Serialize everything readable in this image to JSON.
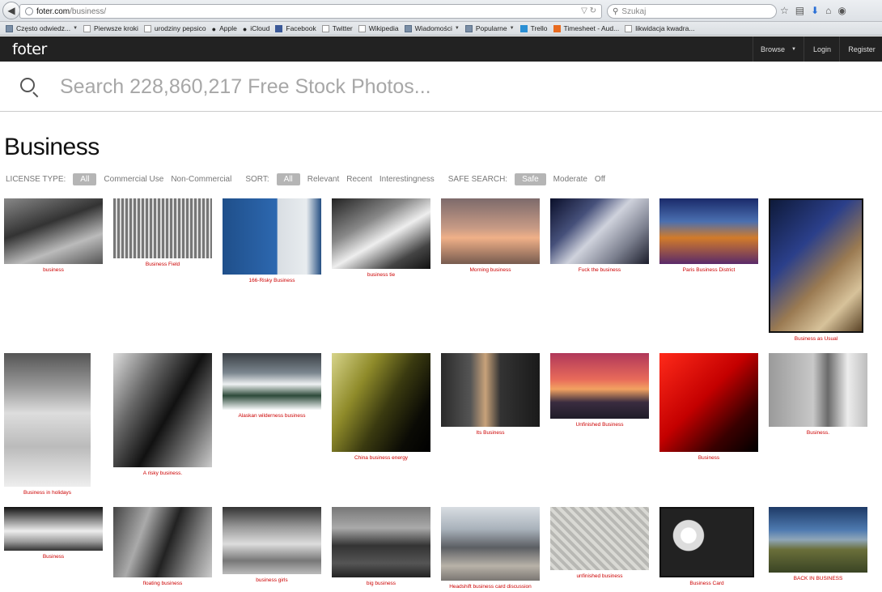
{
  "browser": {
    "url_host": "foter.com",
    "url_path": "/business/",
    "search_placeholder": "Szukaj",
    "bookmarks": [
      {
        "label": "Często odwiedz...",
        "icon": "folder-icon",
        "caret": true
      },
      {
        "label": "Pierwsze kroki",
        "icon": "page-icon"
      },
      {
        "label": "urodziny pepsico",
        "icon": "page-icon"
      },
      {
        "label": "Apple",
        "icon": "apple-icon"
      },
      {
        "label": "iCloud",
        "icon": "apple-icon"
      },
      {
        "label": "Facebook",
        "icon": "facebook-icon"
      },
      {
        "label": "Twitter",
        "icon": "page-icon"
      },
      {
        "label": "Wikipedia",
        "icon": "page-icon"
      },
      {
        "label": "Wiadomości",
        "icon": "folder-icon",
        "caret": true
      },
      {
        "label": "Popularne",
        "icon": "folder-icon",
        "caret": true
      },
      {
        "label": "Trello",
        "icon": "trello-icon"
      },
      {
        "label": "Timesheet - Aud...",
        "icon": "timesheet-icon"
      },
      {
        "label": "likwidacja kwadra...",
        "icon": "page-icon"
      }
    ]
  },
  "header": {
    "logo": "foter",
    "nav": {
      "browse": "Browse",
      "login": "Login",
      "register": "Register"
    }
  },
  "search": {
    "placeholder": "Search 228,860,217 Free Stock Photos..."
  },
  "page": {
    "title": "Business"
  },
  "filters": {
    "license_label": "LICENSE TYPE:",
    "license_options": [
      "All",
      "Commercial Use",
      "Non-Commercial"
    ],
    "sort_label": "SORT:",
    "sort_options": [
      "All",
      "Relevant",
      "Recent",
      "Interestingness"
    ],
    "safe_label": "SAFE SEARCH:",
    "safe_options": [
      "Safe",
      "Moderate",
      "Off"
    ]
  },
  "photos": [
    {
      "caption": "business",
      "bg": "linear-gradient(160deg,#888 0%,#333 40%,#bbb 70%,#555 100%)"
    },
    {
      "caption": "Business Field",
      "bg": "repeating-linear-gradient(90deg,#777 0 3px,#ddd 3px 5px),linear-gradient(#fff,#fff)"
    },
    {
      "caption": "166-Risky Business",
      "bg": "linear-gradient(90deg,#1f4f8a 0%,#2d68b0 55%,#d9dee3 56%,#e8ecef 85%,#254f82 100%)"
    },
    {
      "caption": "business tie",
      "bg": "linear-gradient(150deg,#222 0%,#888 35%,#eee 55%,#444 80%,#111 100%)"
    },
    {
      "caption": "Morning business",
      "bg": "linear-gradient(#7d6a6b 0%,#c79a85 45%,#f0b088 60%,#775b4f 100%)"
    },
    {
      "caption": "Fuck the business",
      "bg": "linear-gradient(135deg,#0a0f2a 0%,#46507a 30%,#cfd2dc 50%,#7b7f8e 75%,#1b1d2b 100%)"
    },
    {
      "caption": "Paris Business District",
      "bg": "linear-gradient(#1a2a6a 0%,#4a6fb0 35%,#d27b2a 60%,#5a2a6a 100%)"
    },
    {
      "caption": "Business as Usual",
      "bg": "linear-gradient(135deg,#0e1a3a 0%,#2b3f8a 35%,#9a7a52 60%,#d7c29a 80%,#5a4326 100%)"
    },
    {
      "caption": "Business in holidays",
      "bg": "linear-gradient(#555 0%,#999 25%,#ddd 45%,#bbb 70%,#eee 100%)"
    },
    {
      "caption": "A risky business.",
      "bg": "linear-gradient(120deg,#ddd 0%,#666 30%,#111 55%,#777 80%,#ccc 100%)"
    },
    {
      "caption": "Alaskan wilderness business",
      "bg": "linear-gradient(#3a3f44 0%,#7b868f 35%,#eef1f2 55%,#2d4a3a 75%,#f7f9fa 100%)"
    },
    {
      "caption": "China business energy",
      "bg": "linear-gradient(120deg,#d7d48a 0%,#8f8b2a 30%,#3a3a10 55%,#0b0b05 80%,#000 100%)"
    },
    {
      "caption": "Its Business",
      "bg": "linear-gradient(90deg,#2a2a2a 0%,#555 30%,#c8a27a 45%,#333 60%,#1a1a1a 100%)"
    },
    {
      "caption": "Unfinished Business",
      "bg": "linear-gradient(#b0385a 0%,#e86a5a 40%,#f2a261 55%,#3a2c40 75%,#1f1c28 100%)"
    },
    {
      "caption": "Business",
      "bg": "linear-gradient(135deg,#ff2a1a 0%,#c40000 45%,#3a0000 75%,#000 100%)"
    },
    {
      "caption": "Business.",
      "bg": "linear-gradient(90deg,#9a9a9a 0%,#c8c8c8 45%,#6a6a6a 60%,#ededed 80%,#bdbdbd 100%)"
    },
    {
      "caption": "Business",
      "bg": "linear-gradient(#111 0%,#777 25%,#eee 55%,#999 80%,#333 100%)"
    },
    {
      "caption": "floating business",
      "bg": "linear-gradient(110deg,#444 0%,#aaa 30%,#222 55%,#888 80%,#ccc 100%)"
    },
    {
      "caption": "business girls",
      "bg": "linear-gradient(#333 0%,#999 30%,#ddd 55%,#777 80%,#bbb 100%)"
    },
    {
      "caption": "big business",
      "bg": "linear-gradient(#777 0%,#aaa 30%,#333 55%,#555 80%,#222 100%)"
    },
    {
      "caption": "Headshift business card discussion",
      "bg": "linear-gradient(#d8dde2 0%,#a9b2bb 30%,#5b5e63 55%,#b8b2a8 80%,#7a7672 100%)"
    },
    {
      "caption": "unfinished business",
      "bg": "repeating-linear-gradient(45deg,#b8b8b4 0 4px,#d9d9d4 4px 8px)"
    },
    {
      "caption": "Business Card",
      "bg": "radial-gradient(circle at 30% 40%,#fff 0 10%,#ddd 11% 20%,#222 21% 100%)"
    },
    {
      "caption": "BACK IN BUSINESS",
      "bg": "linear-gradient(#1e3a66 0%,#4e7ab0 35%,#8fa6b8 50%,#6a6f3a 65%,#3a4424 100%)"
    }
  ]
}
